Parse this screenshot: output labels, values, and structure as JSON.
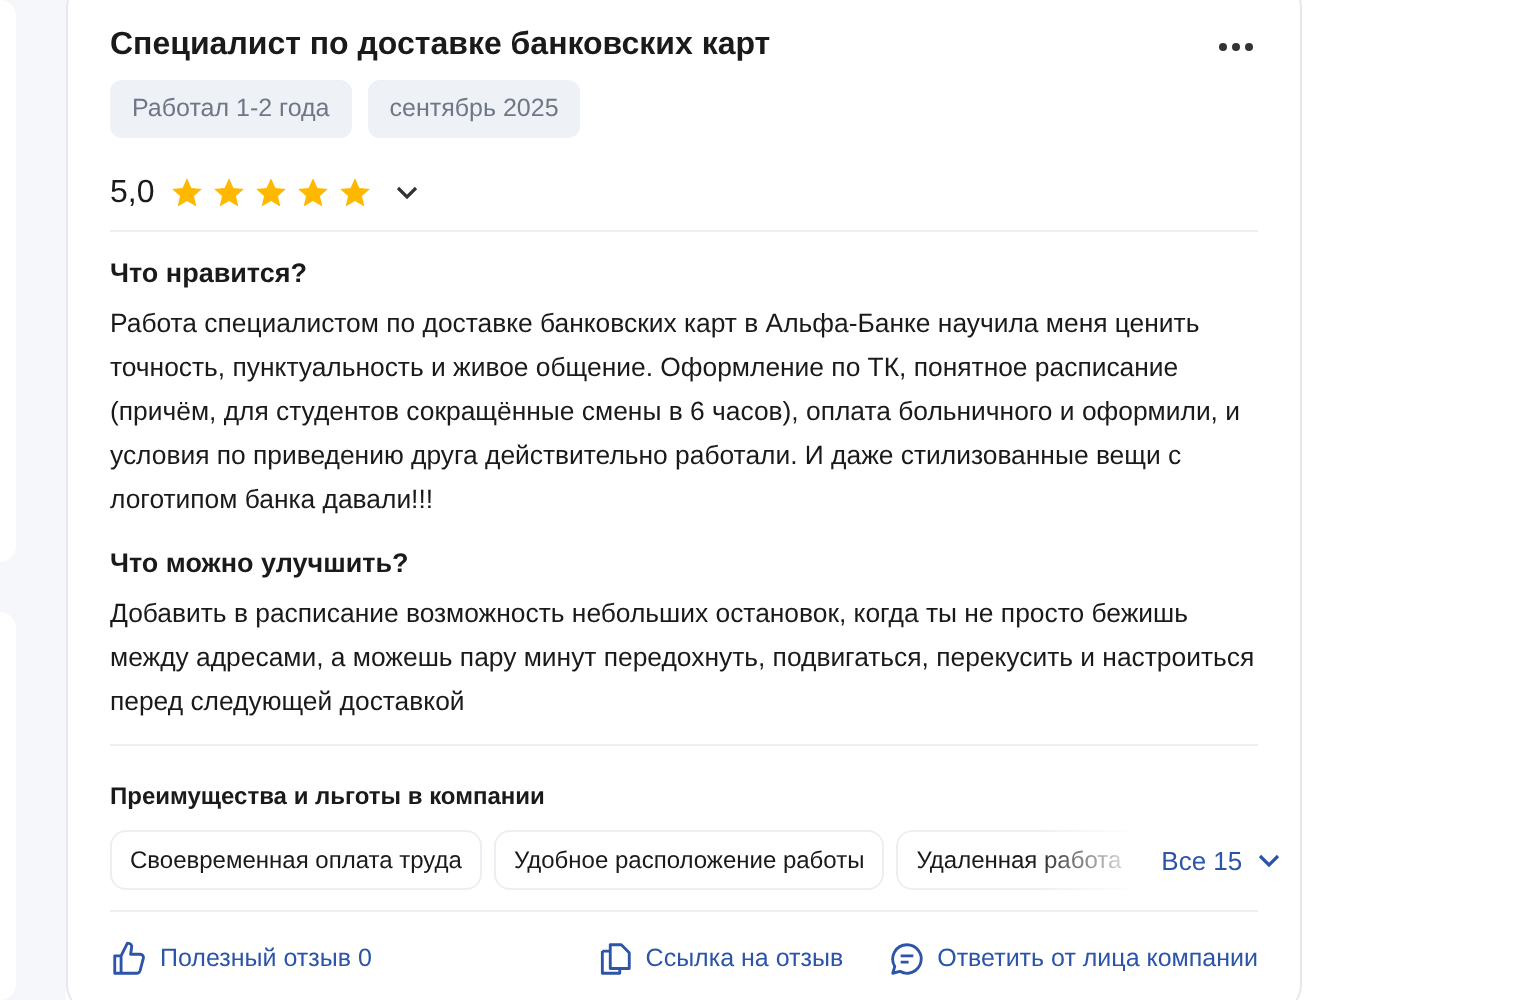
{
  "review": {
    "title": "Специалист по доставке банковских карт",
    "tags": [
      "Работал 1-2 года",
      "сентябрь 2025"
    ],
    "rating": "5,0",
    "stars": 5,
    "sections": [
      {
        "heading": "Что нравится?",
        "text": "Работа специалистом по доставке банковских карт в Альфа-Банке научила меня ценить точность, пунктуальность и живое общение. Оформление по ТК, понятное расписание (причём, для студентов сокращённые смены в 6 часов), оплата больничного и оформили, и условия по приведению друга действительно работали. И даже стилизованные вещи с логотипом банка давали!!!"
      },
      {
        "heading": "Что можно улучшить?",
        "text": "Добавить в расписание возможность небольших остановок, когда ты не просто бежишь между адресами, а можешь пару минут передохнуть, подвигаться, перекусить и настроиться перед следующей доставкой"
      }
    ],
    "benefits": {
      "heading": "Преимущества и льготы в компании",
      "items": [
        "Своевременная оплата труда",
        "Удобное расположение работы",
        "Удаленная работа"
      ],
      "more": "Все 15"
    },
    "actions": [
      {
        "kind": "like",
        "label": "Полезный отзыв 0"
      },
      {
        "kind": "link",
        "label": "Ссылка на отзыв"
      },
      {
        "kind": "reply",
        "label": "Ответить от лица компании"
      }
    ]
  }
}
